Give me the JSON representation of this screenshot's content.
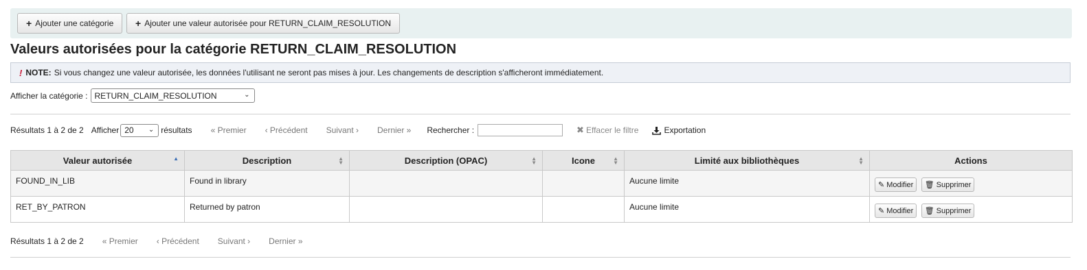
{
  "toolbar": {
    "add_category_label": "Ajouter une catégorie",
    "add_value_label": "Ajouter une valeur autorisée pour RETURN_CLAIM_RESOLUTION"
  },
  "page_title": "Valeurs autorisées pour la catégorie RETURN_CLAIM_RESOLUTION",
  "note": {
    "label": "NOTE:",
    "text": "Si vous changez une valeur autorisée, les données l'utilisant ne seront pas mises à jour. Les changements de description s'afficheront immédiatement."
  },
  "category_filter": {
    "label": "Afficher la catégorie :",
    "selected": "RETURN_CLAIM_RESOLUTION"
  },
  "pager_top": {
    "results": "Résultats 1 à 2 de 2",
    "show_label": "Afficher",
    "page_size": "20",
    "results_suffix": "résultats",
    "first": "« Premier",
    "previous": "‹ Précédent",
    "next": "Suivant ›",
    "last": "Dernier »",
    "search_label": "Rechercher :",
    "search_value": "",
    "clear_filter": "Effacer le filtre",
    "export": "Exportation"
  },
  "table": {
    "columns": [
      "Valeur autorisée",
      "Description",
      "Description (OPAC)",
      "Icone",
      "Limité aux bibliothèques",
      "Actions"
    ],
    "rows": [
      {
        "value": "FOUND_IN_LIB",
        "description": "Found in library",
        "description_opac": "",
        "icon": "",
        "libraries": "Aucune limite"
      },
      {
        "value": "RET_BY_PATRON",
        "description": "Returned by patron",
        "description_opac": "",
        "icon": "",
        "libraries": "Aucune limite"
      }
    ],
    "edit_label": "Modifier",
    "delete_label": "Supprimer"
  },
  "pager_bottom": {
    "results": "Résultats 1 à 2 de 2",
    "first": "« Premier",
    "previous": "‹ Précédent",
    "next": "Suivant ›",
    "last": "Dernier »"
  },
  "icons": {
    "plus": "plus-icon",
    "warning": "exclamation-icon",
    "clear": "x-icon",
    "export": "download-icon",
    "edit": "pencil-icon",
    "delete": "trash-icon"
  },
  "colors": {
    "toolbar_bg": "#e8f1f1",
    "note_bg": "#eef1f6",
    "note_mark": "#c8102e",
    "header_bg": "#e6e6e6",
    "active_sort": "#3a6db5"
  }
}
